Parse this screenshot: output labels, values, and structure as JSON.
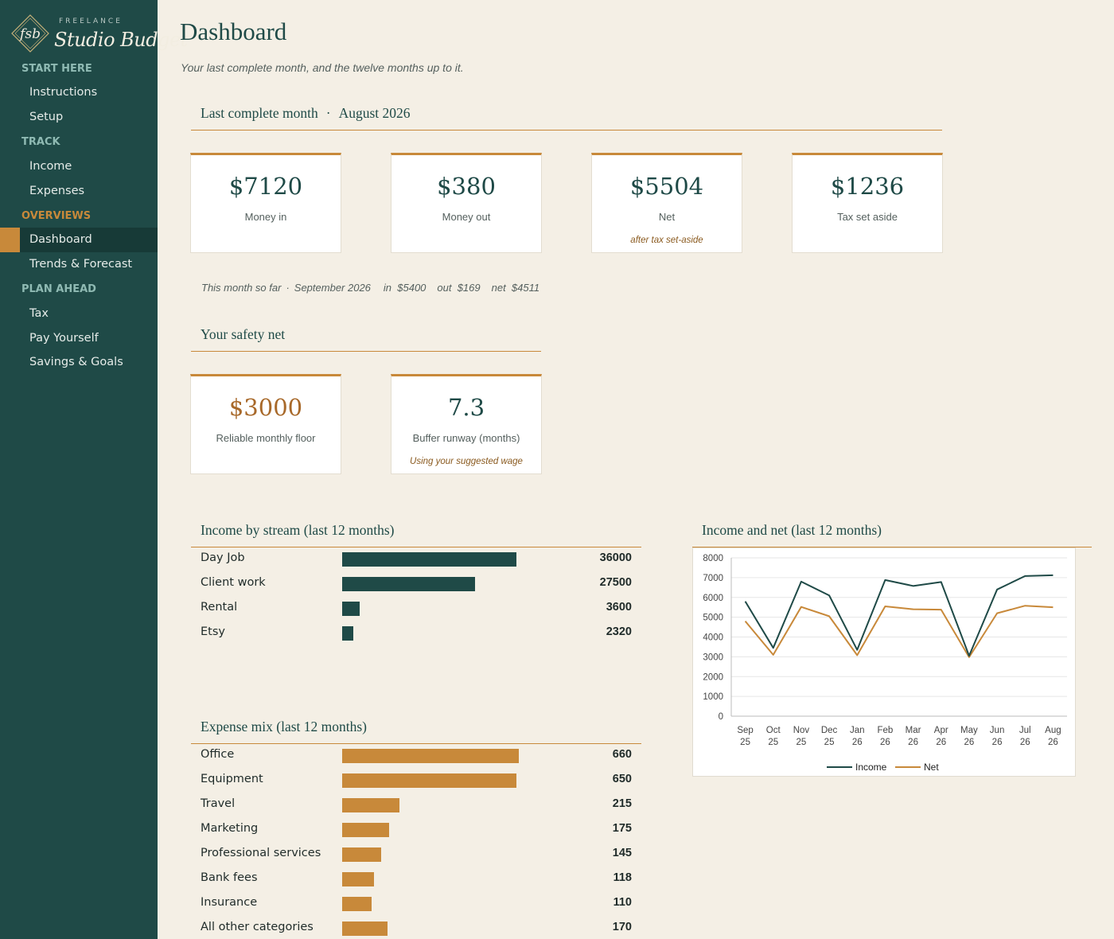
{
  "brand": {
    "small": "FREELANCE",
    "name": "Studio Budget",
    "mark": "fsb"
  },
  "sidebar": {
    "sections": [
      {
        "label": "START HERE",
        "items": [
          "Instructions",
          "Setup"
        ]
      },
      {
        "label": "TRACK",
        "items": [
          "Income",
          "Expenses"
        ]
      },
      {
        "label": "OVERVIEWS",
        "items": [
          "Dashboard",
          "Trends & Forecast"
        ]
      },
      {
        "label": "PLAN AHEAD",
        "items": [
          "Tax",
          "Pay Yourself",
          "Savings & Goals"
        ]
      }
    ],
    "active": "Dashboard"
  },
  "page": {
    "title": "Dashboard",
    "subtitle": "Your last complete month, and the twelve months up to it."
  },
  "last_month": {
    "heading": "Last complete month",
    "separator": "·",
    "month": "August 2026",
    "cards": [
      {
        "value": "$7120",
        "label": "Money in",
        "note": ""
      },
      {
        "value": "$380",
        "label": "Money out",
        "note": ""
      },
      {
        "value": "$5504",
        "label": "Net",
        "note": "after tax set-aside"
      },
      {
        "value": "$1236",
        "label": "Tax set aside",
        "note": ""
      }
    ]
  },
  "so_far": {
    "label": "This month so far",
    "separator": "·",
    "month": "September 2026",
    "in": "in  $5400",
    "out": "out  $169",
    "net": "net  $4511"
  },
  "safety_net": {
    "heading": "Your safety net",
    "cards": [
      {
        "value": "$3000",
        "label": "Reliable monthly floor",
        "note": ""
      },
      {
        "value": "7.3",
        "label": "Buffer runway (months)",
        "note": "Using your suggested wage"
      }
    ]
  },
  "income_streams": {
    "heading": "Income by stream (last 12 months)",
    "color": "#1f4a47",
    "rows": [
      {
        "name": "Day Job",
        "value": 36000
      },
      {
        "name": "Client work",
        "value": 27500
      },
      {
        "name": "Rental",
        "value": 3600
      },
      {
        "name": "Etsy",
        "value": 2320
      }
    ]
  },
  "expense_mix": {
    "heading": "Expense mix (last 12 months)",
    "color": "#c8893a",
    "rows": [
      {
        "name": "Office",
        "value": 660
      },
      {
        "name": "Equipment",
        "value": 650
      },
      {
        "name": "Travel",
        "value": 215
      },
      {
        "name": "Marketing",
        "value": 175
      },
      {
        "name": "Professional services",
        "value": 145
      },
      {
        "name": "Bank fees",
        "value": 118
      },
      {
        "name": "Insurance",
        "value": 110
      },
      {
        "name": "All other categories",
        "value": 170
      }
    ]
  },
  "chart_heading": "Income and net (last 12 months)",
  "chart_data": {
    "type": "line",
    "title": "Income and net (last 12 months)",
    "categories": [
      "Sep 25",
      "Oct 25",
      "Nov 25",
      "Dec 25",
      "Jan 26",
      "Feb 26",
      "Mar 26",
      "Apr 26",
      "May 26",
      "Jun 26",
      "Jul 26",
      "Aug 26"
    ],
    "ylim": [
      0,
      8000
    ],
    "yticks": [
      0,
      1000,
      2000,
      3000,
      4000,
      5000,
      6000,
      7000,
      8000
    ],
    "grid": true,
    "legend": "bottom",
    "series": [
      {
        "name": "Income",
        "color": "#1f4a47",
        "values": [
          5800,
          3450,
          6800,
          6100,
          3350,
          6880,
          6580,
          6780,
          3050,
          6400,
          7080,
          7120
        ]
      },
      {
        "name": "Net",
        "color": "#c8893a",
        "values": [
          4800,
          3100,
          5520,
          5050,
          3080,
          5550,
          5400,
          5380,
          2980,
          5200,
          5580,
          5504
        ]
      }
    ]
  }
}
